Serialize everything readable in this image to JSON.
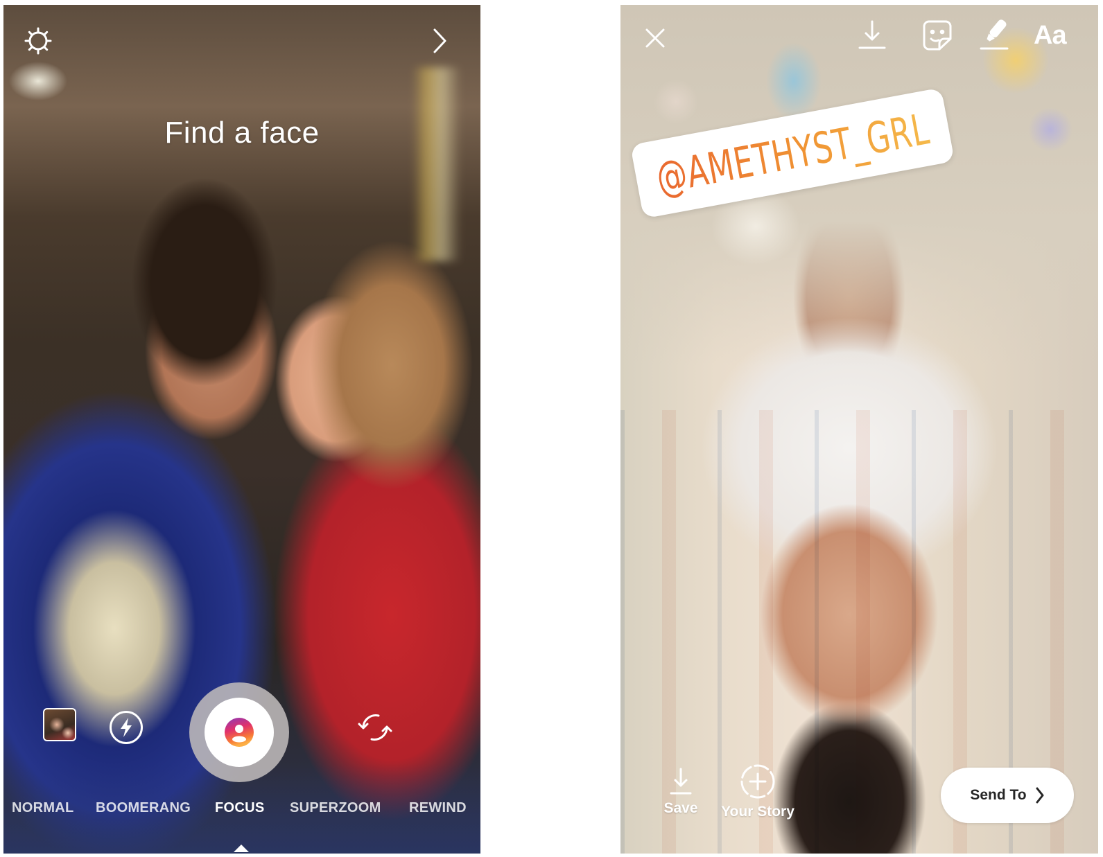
{
  "left_screen": {
    "name": "Instagram Stories camera",
    "prompt": "Find a face",
    "top_bar": {
      "settings_icon": "gear-icon",
      "next_icon": "chevron-right-icon"
    },
    "controls": {
      "gallery_icon": "gallery-thumbnail",
      "flash_icon": "flash-icon",
      "shutter_icon": "focus-person-icon",
      "flip_icon": "flip-camera-icon"
    },
    "modes": [
      {
        "label": "NORMAL",
        "active": false
      },
      {
        "label": "BOOMERANG",
        "active": false
      },
      {
        "label": "FOCUS",
        "active": true
      },
      {
        "label": "SUPERZOOM",
        "active": false
      },
      {
        "label": "REWIND",
        "active": false
      }
    ],
    "colors": {
      "focus_gradient_start": "#8a3ab9",
      "focus_gradient_mid": "#e1306c",
      "focus_gradient_end": "#fcaf45"
    }
  },
  "right_screen": {
    "name": "Instagram Stories editor",
    "top_bar": {
      "close_icon": "close-icon",
      "download_icon": "download-icon",
      "sticker_icon": "sticker-icon",
      "draw_icon": "marker-icon",
      "text_tool_label": "Aa"
    },
    "mention_sticker": {
      "text": "@AMETHYST_GRL",
      "gradient": [
        "#e9682f",
        "#f09433",
        "#f5b94a"
      ]
    },
    "bottom_bar": {
      "save_label": "Save",
      "story_label": "Your Story",
      "send_label": "Send To"
    }
  }
}
